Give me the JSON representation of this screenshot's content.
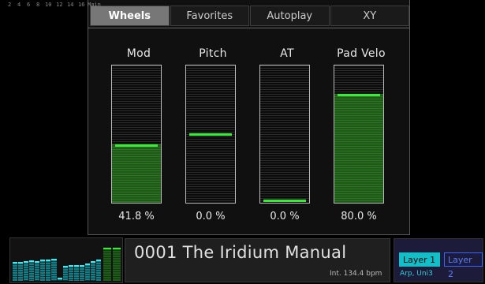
{
  "tabs": [
    {
      "label": "Wheels",
      "active": true
    },
    {
      "label": "Favorites",
      "active": false
    },
    {
      "label": "Autoplay",
      "active": false
    },
    {
      "label": "XY",
      "active": false
    }
  ],
  "meters": [
    {
      "title": "Mod",
      "value_text": "41.8 %",
      "level": 0.418,
      "fill": true
    },
    {
      "title": "Pitch",
      "value_text": "0.0 %",
      "level": 0.5,
      "fill": false
    },
    {
      "title": "AT",
      "value_text": "0.0 %",
      "level": 0.0,
      "fill": false
    },
    {
      "title": "Pad Velo",
      "value_text": "80.0 %",
      "level": 0.8,
      "fill": true
    }
  ],
  "mixer": {
    "channel_labels": [
      "2",
      "4",
      "6",
      "8",
      "10",
      "12",
      "14",
      "16",
      "Main"
    ],
    "channel_levels": [
      0.7,
      0.72,
      0.74,
      0.76,
      0.74,
      0.78,
      0.8,
      0.82,
      0.12,
      0.55,
      0.6,
      0.58,
      0.6,
      0.64,
      0.74,
      0.8
    ],
    "main_levels": [
      0.92,
      0.92
    ]
  },
  "patch": {
    "name": "0001 The Iridium Manual",
    "tempo": "Int. 134.4 bpm"
  },
  "layers": {
    "layer1": "Layer 1",
    "layer2": "Layer 2",
    "arp": "Arp, Uni3"
  },
  "colors": {
    "accent_green": "#33ee33",
    "fill_green": "#1f5a1a",
    "layer_cyan": "#12bfc8",
    "layer_blue": "#3a63ff"
  }
}
